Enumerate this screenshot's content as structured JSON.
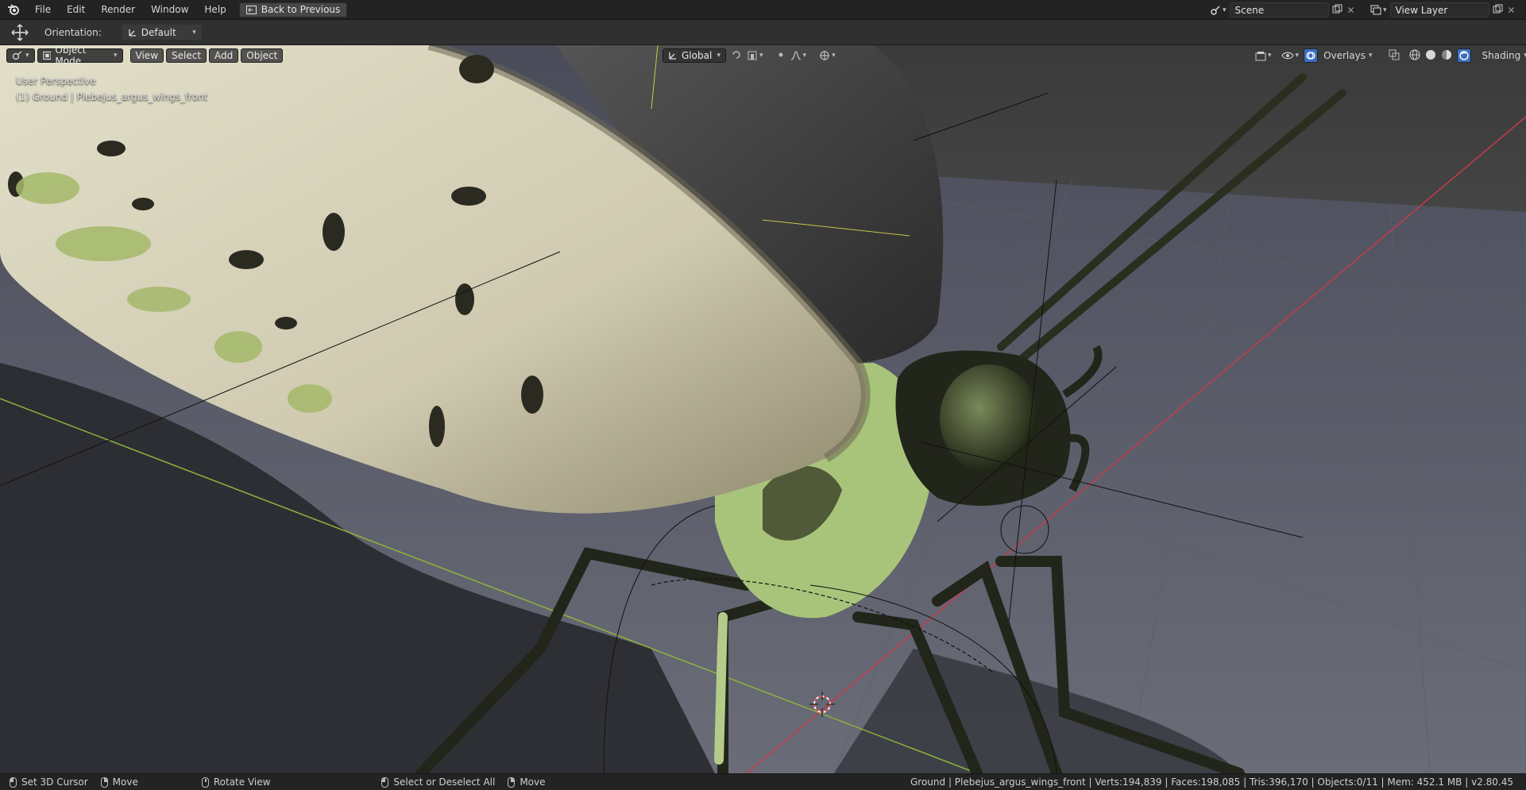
{
  "menu": {
    "file": "File",
    "edit": "Edit",
    "render": "Render",
    "window": "Window",
    "help": "Help",
    "back_to_previous": "Back to Previous"
  },
  "scene": {
    "name": "Scene",
    "view_layer": "View Layer"
  },
  "toolbar": {
    "orientation_label": "Orientation:",
    "orientation_value": "Default"
  },
  "viewport_header": {
    "mode": "Object Mode",
    "view": "View",
    "select": "Select",
    "add": "Add",
    "object": "Object",
    "transform_orientation": "Global",
    "overlays": "Overlays",
    "shading": "Shading"
  },
  "viewport_overlay": {
    "perspective": "User Perspective",
    "active_object": "(1) Ground | Plebejus_argus_wings_front"
  },
  "statusbar": {
    "set_cursor": "Set 3D Cursor",
    "move1": "Move",
    "rotate_view": "Rotate View",
    "select_all": "Select or Deselect All",
    "move2": "Move",
    "stats": "Ground | Plebejus_argus_wings_front | Verts:194,839 | Faces:198,085 | Tris:396,170 | Objects:0/11 | Mem: 452.1 MB | v2.80.45"
  },
  "colors": {
    "accent": "#5680c2",
    "x_axis": "#c43c4c",
    "y_axis": "#8cb43c",
    "wing": "#d6d2b8",
    "body": "#a8c47a"
  },
  "icons": [
    "blender-logo-icon",
    "back-icon",
    "scene-icon",
    "view-layer-icon",
    "move-tool-icon",
    "editor-type-icon",
    "object-mode-icon",
    "orientation-icon",
    "snap-icon",
    "proportional-icon",
    "gizmo-icon",
    "visibility-icon",
    "overlays-icon",
    "xray-icon",
    "wireframe-shading-icon",
    "solid-shading-icon",
    "material-shading-icon",
    "rendered-shading-icon"
  ]
}
